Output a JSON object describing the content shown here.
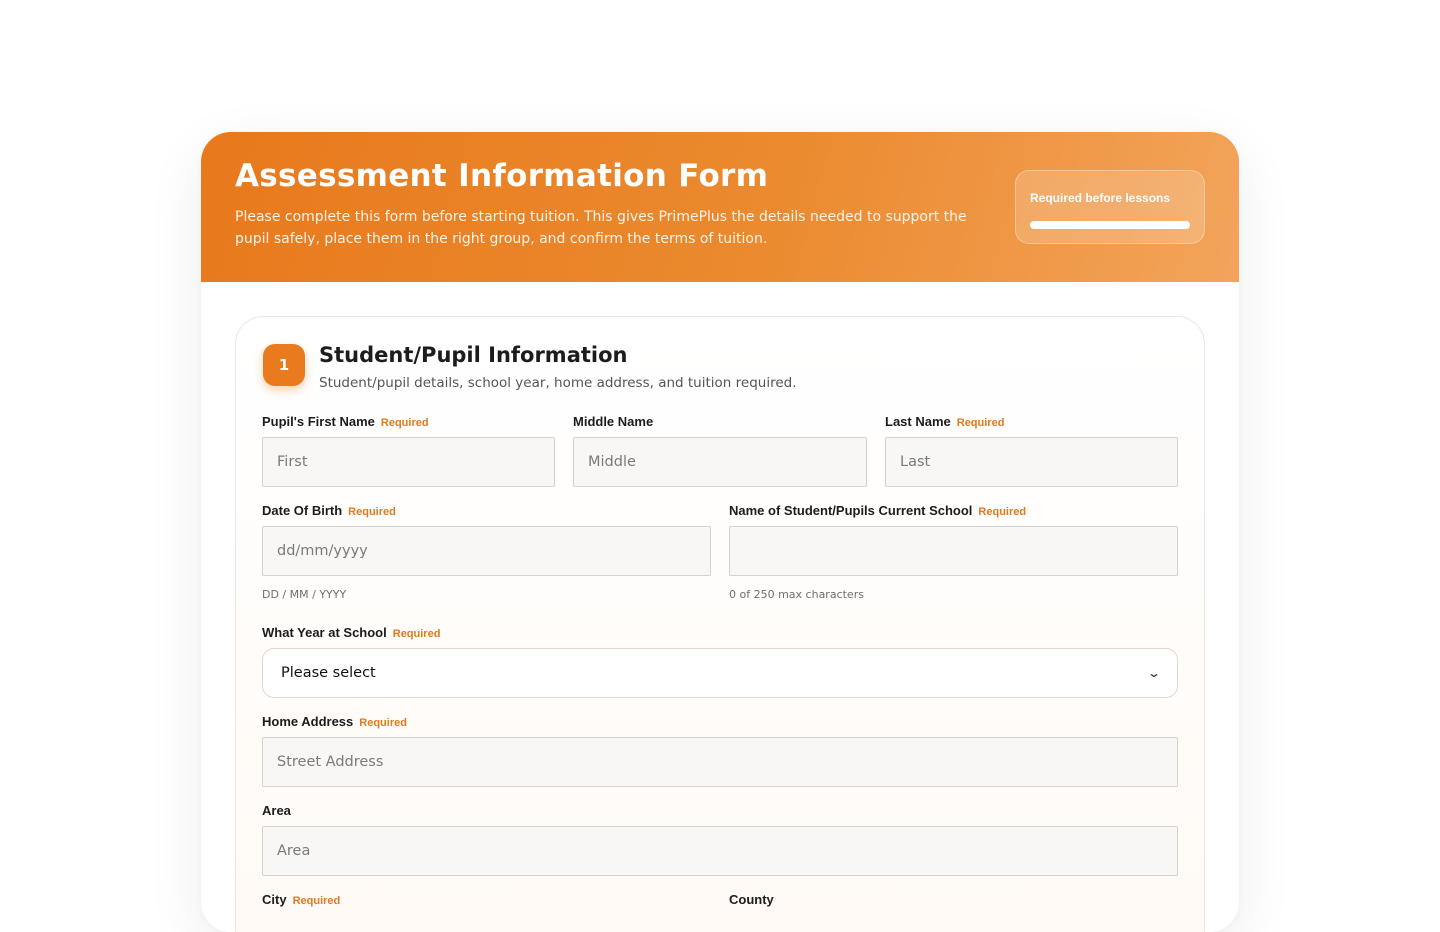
{
  "header": {
    "title": "Assessment Information Form",
    "description": "Please complete this form before starting tuition. This gives PrimePlus the details needed to support the pupil safely, place them in the right group, and confirm the terms of tuition.",
    "badge_label": "Required before lessons",
    "badge_progress": 1.0
  },
  "section": {
    "number": "1",
    "title": "Student/Pupil Information",
    "subtitle": "Student/pupil details, school year, home address, and tuition required."
  },
  "required_text": "Required",
  "fields": {
    "first_name": {
      "label": "Pupil's First Name",
      "placeholder": "First"
    },
    "middle_name": {
      "label": "Middle Name",
      "placeholder": "Middle"
    },
    "last_name": {
      "label": "Last Name",
      "placeholder": "Last"
    },
    "dob": {
      "label": "Date Of Birth",
      "placeholder": "dd/mm/yyyy",
      "hint": "DD / MM / YYYY"
    },
    "school": {
      "label": "Name of Student/Pupils Current School",
      "placeholder": "",
      "hint": "0 of 250 max characters"
    },
    "year": {
      "label": "What Year at School",
      "selected": "Please select"
    },
    "street": {
      "label": "Home Address",
      "placeholder": "Street Address"
    },
    "area": {
      "label": "Area",
      "placeholder": "Area"
    },
    "city": {
      "label": "City"
    },
    "county": {
      "label": "County"
    }
  },
  "colors": {
    "accent": "#e97a1d",
    "required": "#e07a1c",
    "hero_start": "#e8791c",
    "hero_end": "#f3a45b"
  },
  "icons": {
    "select_chevron": "chevron-down-icon"
  }
}
